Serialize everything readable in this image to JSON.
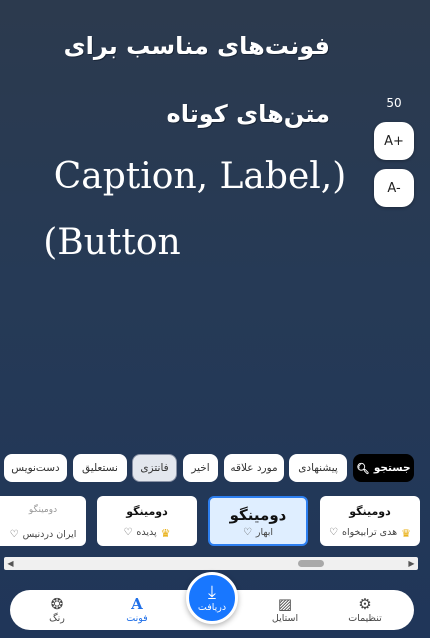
{
  "preview": {
    "title_line1": "فونت‌های مناسب برای",
    "title_line2": "متن‌های کوتاه",
    "latin_line1": "Caption, Label,)",
    "latin_line2": "(Button",
    "size_value": "50",
    "size_increase_label": "A+",
    "size_decrease_label": "A-"
  },
  "categories": {
    "search_label": "جستجو",
    "items": [
      "پیشنهادی",
      "مورد علاقه",
      "اخیر",
      "فانتزی",
      "نستعلیق",
      "دست‌نویس"
    ],
    "active": "فانتزی"
  },
  "fonts": [
    {
      "name": "دومینگو",
      "sub": "هدی ترابیخواه",
      "premium": true,
      "selected": false
    },
    {
      "name": "دومینگو",
      "sub": "ابهار",
      "premium": false,
      "selected": true
    },
    {
      "name": "دومینگو",
      "sub": "پدیده",
      "premium": true,
      "selected": false
    },
    {
      "name": "دومینگو",
      "sub": "ایران دردنیس",
      "premium": false,
      "selected": false
    }
  ],
  "nav": {
    "settings": "تنظیمات",
    "style": "استایل",
    "download": "دریافت",
    "font": "فونت",
    "color": "رنگ"
  },
  "colors": {
    "accent": "#1877ff",
    "selected_border": "#2d7ff0",
    "crown": "#e7a900"
  }
}
